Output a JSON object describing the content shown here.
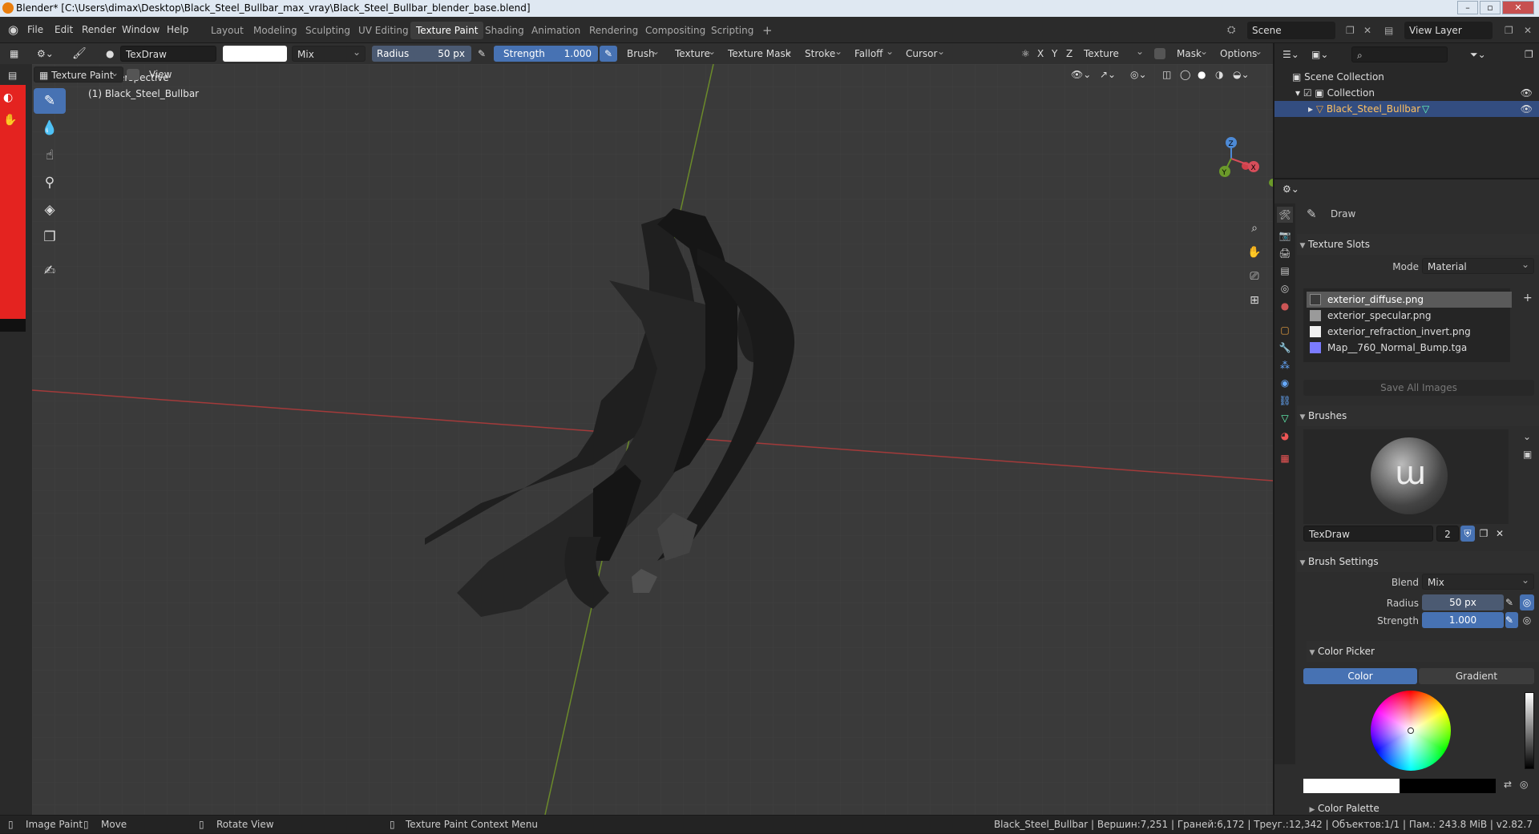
{
  "titlebar": {
    "title": "Blender* [C:\\Users\\dimax\\Desktop\\Black_Steel_Bullbar_max_vray\\Black_Steel_Bullbar_blender_base.blend]"
  },
  "menu": {
    "file": "File",
    "edit": "Edit",
    "render": "Render",
    "window": "Window",
    "help": "Help"
  },
  "workspaces": [
    "Layout",
    "Modeling",
    "Sculpting",
    "UV Editing",
    "Texture Paint",
    "Shading",
    "Animation",
    "Rendering",
    "Compositing",
    "Scripting"
  ],
  "active_workspace": "Texture Paint",
  "scene": {
    "scene_name": "Scene",
    "view_layer": "View Layer"
  },
  "tool_header": {
    "brush_name": "TexDraw",
    "blend": "Mix",
    "radius_label": "Radius",
    "radius_value": "50 px",
    "strength_label": "Strength",
    "strength_value": "1.000",
    "brush_menu": "Brush",
    "texture_menu": "Texture",
    "texture_mask_menu": "Texture Mask",
    "stroke_menu": "Stroke",
    "falloff_menu": "Falloff",
    "cursor_menu": "Cursor",
    "axis_x": "X",
    "axis_y": "Y",
    "axis_z": "Z",
    "texture_slots_menu": "Texture Slots",
    "mask_menu": "Mask",
    "options_menu": "Options"
  },
  "viewport_header": {
    "mode": "Texture Paint",
    "view_menu": "View"
  },
  "viewport": {
    "perspective_label": "User Perspective",
    "object_label": "(1) Black_Steel_Bullbar",
    "gizmo_x": "X",
    "gizmo_y": "Y",
    "gizmo_z": "Z"
  },
  "outliner": {
    "scene_collection": "Scene Collection",
    "collection": "Collection",
    "object": "Black_Steel_Bullbar"
  },
  "properties": {
    "tool_name": "Draw",
    "texture_slots_title": "Texture Slots",
    "mode_label": "Mode",
    "mode_value": "Material",
    "slots": [
      {
        "name": "exterior_diffuse.png",
        "color": "#3a3a3a"
      },
      {
        "name": "exterior_specular.png",
        "color": "#9a9a9a"
      },
      {
        "name": "exterior_refraction_invert.png",
        "color": "#f0f0f0"
      },
      {
        "name": "Map__760_Normal_Bump.tga",
        "color": "#7b7bff"
      }
    ],
    "save_all_images": "Save All Images",
    "brushes_title": "Brushes",
    "brush_name": "TexDraw",
    "brush_users": "2",
    "brush_settings_title": "Brush Settings",
    "blend_label": "Blend",
    "blend_value": "Mix",
    "radius_label": "Radius",
    "radius_value": "50 px",
    "strength_label": "Strength",
    "strength_value": "1.000",
    "color_picker_title": "Color Picker",
    "color_tab": "Color",
    "gradient_tab": "Gradient",
    "color_palette_title": "Color Palette"
  },
  "statusbar": {
    "image_paint": "Image Paint",
    "move": "Move",
    "rotate_view": "Rotate View",
    "context_menu": "Texture Paint Context Menu",
    "stats": "Black_Steel_Bullbar | Вершин:7,251 | Граней:6,172 | Треуг.:12,342 | Объектов:1/1 | Пам.: 243.8 MiB | v2.82.7"
  },
  "colors": {
    "accent": "#4772b3",
    "paint_color": "#ffffff",
    "selection": "#334d80"
  }
}
